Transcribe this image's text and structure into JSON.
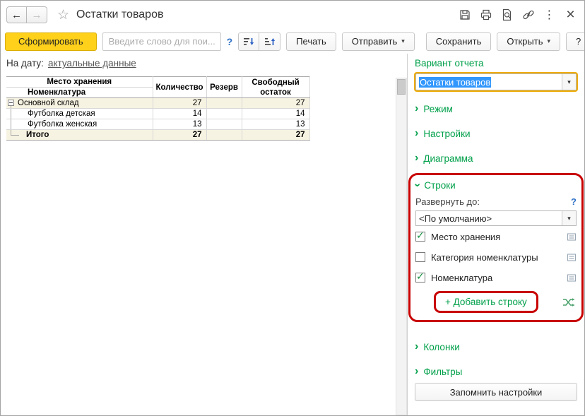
{
  "titlebar": {
    "back": "←",
    "forward": "→",
    "star": "☆",
    "title": "Остатки товаров",
    "more": "⋮",
    "close": "×"
  },
  "toolbar": {
    "generate": "Сформировать",
    "search_placeholder": "Введите слово для пои...",
    "search_help": "?",
    "print": "Печать",
    "send": "Отправить",
    "save": "Сохранить",
    "open": "Открыть",
    "help": "?",
    "arrow": "▾"
  },
  "report": {
    "date_label": "На дату:",
    "date_value": "актуальные данные",
    "table": {
      "header": {
        "col1_top": "Место хранения",
        "col1_bottom": "Номенклатура",
        "qty": "Количество",
        "reserve": "Резерв",
        "free": "Свободный остаток"
      },
      "rows": [
        {
          "name": "Основной склад",
          "qty": "27",
          "reserve": "",
          "free": "27"
        },
        {
          "name": "Футболка детская",
          "qty": "14",
          "reserve": "",
          "free": "14"
        },
        {
          "name": "Футболка женская",
          "qty": "13",
          "reserve": "",
          "free": "13"
        }
      ],
      "total": {
        "name": "Итого",
        "qty": "27",
        "reserve": "",
        "free": "27"
      }
    }
  },
  "panel": {
    "variant_label": "Вариант отчета",
    "variant_value": "Остатки товаров",
    "arrow": "▾",
    "chevron": "›",
    "sections": {
      "mode": "Режим",
      "settings": "Настройки",
      "diagram": "Диаграмма",
      "rows": "Строки",
      "columns": "Колонки",
      "filters": "Фильтры"
    },
    "rows_section": {
      "expand_label": "Развернуть до:",
      "help": "?",
      "default_option": "<По умолчанию>",
      "items": [
        {
          "label": "Место хранения",
          "checked": true
        },
        {
          "label": "Категория номенклатуры",
          "checked": false
        },
        {
          "label": "Номенклатура",
          "checked": true
        }
      ],
      "add_row": "+ Добавить строку"
    },
    "remember_button": "Запомнить настройки"
  },
  "colors": {
    "accent_green": "#00a04a",
    "generate_yellow": "#ffd11a",
    "annotation_red": "#c80000",
    "selection_blue": "#3297fd",
    "focus_orange": "#f0ac00"
  }
}
